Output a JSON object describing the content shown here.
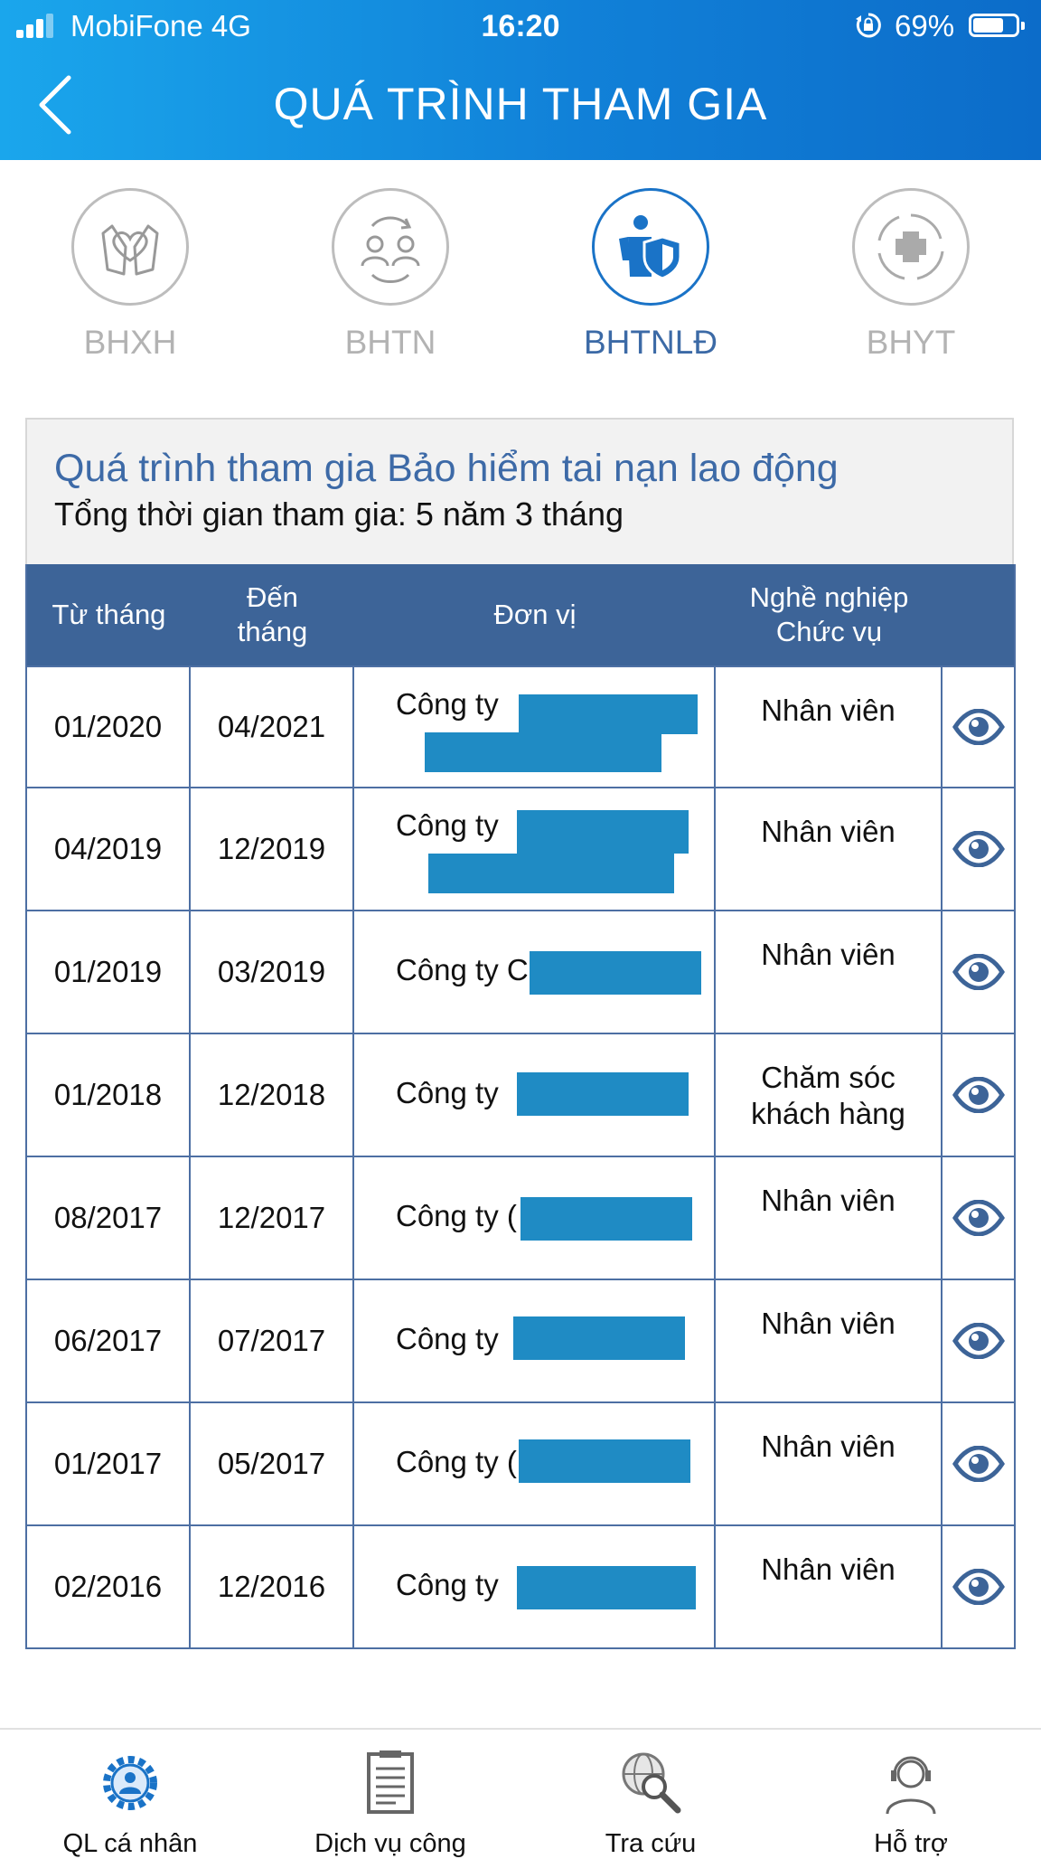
{
  "status_bar": {
    "carrier": "MobiFone  4G",
    "time": "16:20",
    "battery": "69%"
  },
  "header": {
    "title": "QUÁ TRÌNH THAM GIA"
  },
  "tabs": [
    {
      "label": "BHXH",
      "icon": "heart-hands-icon",
      "active": false
    },
    {
      "label": "BHTN",
      "icon": "people-exchange-icon",
      "active": false
    },
    {
      "label": "BHTNLĐ",
      "icon": "worker-shield-icon",
      "active": true
    },
    {
      "label": "BHYT",
      "icon": "medical-cross-icon",
      "active": false
    }
  ],
  "summary": {
    "title": "Quá trình tham gia Bảo hiểm tai nạn lao động",
    "total": "Tổng thời gian tham gia: 5 năm 3 tháng"
  },
  "table": {
    "headers": [
      "Từ tháng",
      "Đến\ntháng",
      "Đơn vị",
      "Nghề nghiệp\nChức vụ"
    ],
    "rows": [
      {
        "from": "01/2020",
        "to": "04/2021",
        "unit": "Công ty",
        "position": "Nhân viên"
      },
      {
        "from": "04/2019",
        "to": "12/2019",
        "unit": "Công ty",
        "position": "Nhân viên"
      },
      {
        "from": "01/2019",
        "to": "03/2019",
        "unit": "Công ty C",
        "position": "Nhân viên"
      },
      {
        "from": "01/2018",
        "to": "12/2018",
        "unit": "Công ty",
        "position": "Chăm sóc\nkhách hàng"
      },
      {
        "from": "08/2017",
        "to": "12/2017",
        "unit": "Công ty (",
        "position": "Nhân viên"
      },
      {
        "from": "06/2017",
        "to": "07/2017",
        "unit": "Công ty",
        "position": "Nhân viên"
      },
      {
        "from": "01/2017",
        "to": "05/2017",
        "unit": "Công ty (",
        "position": "Nhân viên"
      },
      {
        "from": "02/2016",
        "to": "12/2016",
        "unit": "Công ty",
        "position": "Nhân viên"
      }
    ]
  },
  "bottom_nav": [
    {
      "label": "QL cá nhân",
      "icon": "gear-person-icon"
    },
    {
      "label": "Dịch vụ công",
      "icon": "document-icon"
    },
    {
      "label": "Tra cứu",
      "icon": "globe-search-icon"
    },
    {
      "label": "Hỗ trợ",
      "icon": "support-headset-icon"
    }
  ],
  "colors": {
    "header_start": "#1aa6ec",
    "header_end": "#0c6cc9",
    "table_header": "#3d6498",
    "active": "#1a73c7",
    "redaction": "#1f8bc4"
  }
}
